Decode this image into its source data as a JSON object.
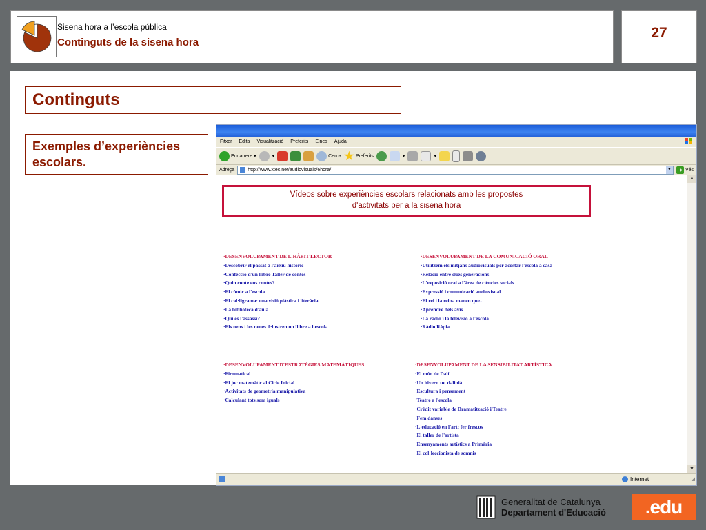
{
  "header": {
    "subtitle": "Sisena hora a l’escola pública",
    "title": "Continguts de la sisena  hora",
    "page_number": "27"
  },
  "slide": {
    "section_title": "Continguts",
    "examples_label": "Exemples d’experiències escolars."
  },
  "browser": {
    "menu": [
      "Fitxer",
      "Edita",
      "Visualització",
      "Preferits",
      "Eines",
      "Ajuda"
    ],
    "toolbar": {
      "back_label": "Endarrere",
      "search_label": "Cerca",
      "favorites_label": "Preferits"
    },
    "address_label": "Adreça",
    "address_value": "http://www.xtec.net/audiovisuals/6hora/",
    "go_label": "Vés",
    "status_zone": "Internet"
  },
  "webpage": {
    "heading_line1": "Vídeos sobre experiències escolars relacionats amb les propostes",
    "heading_line2": "d'activitats per a la sisena hora",
    "sections": [
      {
        "title": "·DESENVOLUPAMENT DE L'HÀBIT LECTOR",
        "items": [
          "·Descobrir el passat a l'arxiu històric",
          "·Confecció d'un llibre Taller de contes",
          "·Quin conte ens contes?",
          "·El còmic a l'escola",
          "·El cal·ligrama: una visió plàstica i literària",
          "·La biblioteca d'aula",
          "·Qui és l'assassí?",
          "·Els nens i les nenes il·lustren un llibre a l'escola"
        ]
      },
      {
        "title": "·DESENVOLUPAMENT DE LA COMUNICACIÓ ORAL",
        "items": [
          "·Utilitzem els mitjans audiovisuals per acostar l'escola a casa",
          "·Relació entre dues generacions",
          "·L'exposició oral a l'àrea de ciències socials",
          "·Expressió i comunicació audiovisual",
          "·El rei i la reina manen que...",
          "·Aprendre dels avis",
          "·La ràdio i la televisió a l'escola",
          "·Ràdio Ràpia"
        ]
      },
      {
        "title": "·DESENVOLUPAMENT D'ESTRATÈGIES MATEMÀTIQUES",
        "items": [
          "·Firomatical",
          "·El joc matemàtic al Cicle Inicial",
          "·Activitats de geometria manipulativa",
          "·Calculant tots som iguals"
        ]
      },
      {
        "title": "·DESENVOLUPAMENT DE LA SENSIBILITAT ARTÍSTICA",
        "items": [
          "·El món de Dalí",
          "·Un hivern tot dalinià",
          "·Escultura i pensament",
          "·Teatre a l'escola",
          "·Crèdit variable de Dramatització i Teatre",
          "·Fem danses",
          "·L'educació en l'art: fer frescos",
          "·El taller de l'artista",
          "·Ensenyaments artístics a Primària",
          "·El col·leccionista de somnis"
        ]
      }
    ]
  },
  "footer": {
    "gencat_line1": "Generalitat de Catalunya",
    "gencat_line2": "Departament d'Educació",
    "edu_logo": ".edu"
  },
  "colors": {
    "accent": "#8b1a00",
    "edu_orange": "#f26522",
    "link_blue": "#1a1aa8",
    "heading_red": "#c5113a"
  }
}
